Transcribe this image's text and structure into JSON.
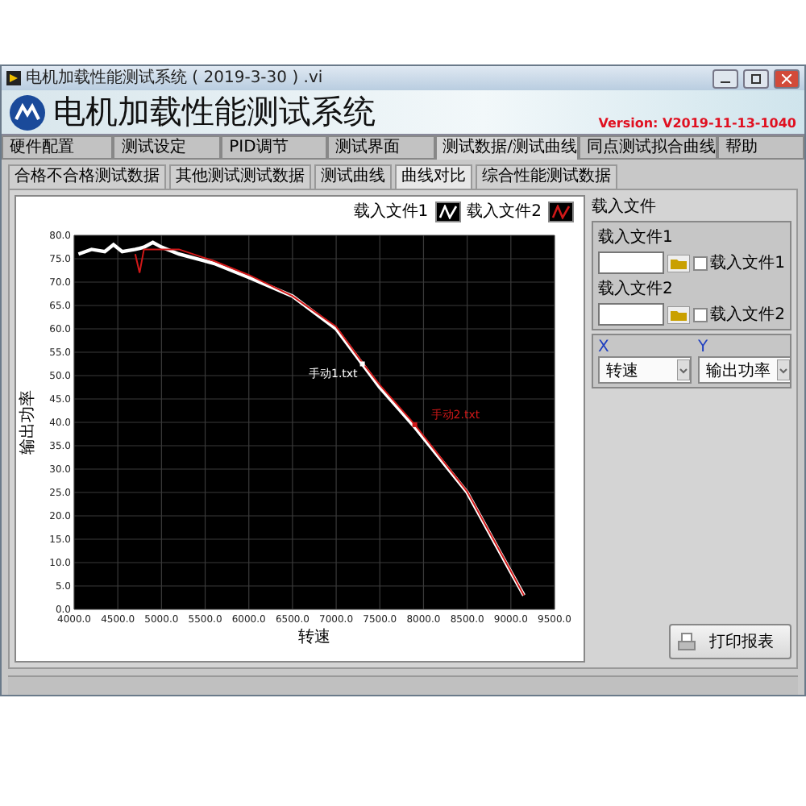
{
  "window": {
    "title": "电机加载性能测试系统 ( 2019-3-30 ) .vi"
  },
  "header": {
    "title": "电机加载性能测试系统",
    "version": "Version: V2019-11-13-1040"
  },
  "main_tabs": [
    {
      "label": "硬件配置",
      "selected": false
    },
    {
      "label": "测试设定",
      "selected": false
    },
    {
      "label": "PID调节",
      "selected": false
    },
    {
      "label": "测试界面",
      "selected": false
    },
    {
      "label": "测试数据/测试曲线",
      "selected": true
    },
    {
      "label": "同点测试拟合曲线",
      "selected": false
    },
    {
      "label": "帮助",
      "selected": false
    }
  ],
  "sub_tabs": [
    {
      "label": "合格不合格测试数据",
      "selected": false
    },
    {
      "label": "其他测试测试数据",
      "selected": false
    },
    {
      "label": "测试曲线",
      "selected": false
    },
    {
      "label": "曲线对比",
      "selected": true
    },
    {
      "label": "综合性能测试数据",
      "selected": false
    }
  ],
  "chart": {
    "chart_data": {
      "type": "line",
      "grid": true,
      "xlabel": "转速",
      "ylabel": "输出功率",
      "x": [
        4050,
        4200,
        4350,
        4450,
        4550,
        4700,
        4750,
        4800,
        4900,
        5000,
        5200,
        5600,
        6000,
        6500,
        7000,
        7300,
        7500,
        7900,
        8500,
        9000,
        9150
      ],
      "series": [
        {
          "name": "载入文件1",
          "color": "#ffffff",
          "values": [
            76,
            77,
            76.5,
            78,
            76.5,
            77,
            77.2,
            77.5,
            78.5,
            77.5,
            76,
            74,
            71,
            67,
            60,
            52.5,
            47.5,
            39,
            25,
            8,
            3
          ]
        },
        {
          "name": "载入文件2",
          "color": "#d01818",
          "values": [
            null,
            null,
            null,
            null,
            null,
            76,
            72,
            77,
            77,
            77,
            77,
            74.5,
            71.5,
            67,
            60.5,
            52.8,
            48,
            39.5,
            25.2,
            8.2,
            3
          ]
        }
      ],
      "xlim": [
        4000,
        9500
      ],
      "ylim": [
        0,
        80
      ],
      "xticks": [
        {
          "value": 4000,
          "label": "4000.0"
        },
        {
          "value": 4500,
          "label": "4500.0"
        },
        {
          "value": 5000,
          "label": "5000.0"
        },
        {
          "value": 5500,
          "label": "5500.0"
        },
        {
          "value": 6000,
          "label": "6000.0"
        },
        {
          "value": 6500,
          "label": "6500.0"
        },
        {
          "value": 7000,
          "label": "7000.0"
        },
        {
          "value": 7500,
          "label": "7500.0"
        },
        {
          "value": 8000,
          "label": "8000.0"
        },
        {
          "value": 8500,
          "label": "8500.0"
        },
        {
          "value": 9000,
          "label": "9000.0"
        },
        {
          "value": 9500,
          "label": "9500.0"
        }
      ],
      "yticks": [
        {
          "value": 0,
          "label": "0.0"
        },
        {
          "value": 5,
          "label": "5.0"
        },
        {
          "value": 10,
          "label": "10.0"
        },
        {
          "value": 15,
          "label": "15.0"
        },
        {
          "value": 20,
          "label": "20.0"
        },
        {
          "value": 25,
          "label": "25.0"
        },
        {
          "value": 30,
          "label": "30.0"
        },
        {
          "value": 35,
          "label": "35.0"
        },
        {
          "value": 40,
          "label": "40.0"
        },
        {
          "value": 45,
          "label": "45.0"
        },
        {
          "value": 50,
          "label": "50.0"
        },
        {
          "value": 55,
          "label": "55.0"
        },
        {
          "value": 60,
          "label": "60.0"
        },
        {
          "value": 65,
          "label": "65.0"
        },
        {
          "value": 70,
          "label": "70.0"
        },
        {
          "value": 75,
          "label": "75.0"
        },
        {
          "value": 80,
          "label": "80.0"
        }
      ],
      "annotations": [
        {
          "text": "手动1.txt",
          "x": 7300,
          "y": 52.5
        },
        {
          "text": "手动2.txt",
          "x": 7900,
          "y": 39.5
        }
      ]
    }
  },
  "load_panel": {
    "title": "载入文件",
    "files": [
      {
        "label": "载入文件1",
        "checkbox_label": "载入文件1",
        "checked": false
      },
      {
        "label": "载入文件2",
        "checkbox_label": "载入文件2",
        "checked": false
      }
    ]
  },
  "axis_select": [
    {
      "label": "X",
      "value": "转速"
    },
    {
      "label": "Y",
      "value": "输出功率"
    }
  ],
  "print_button": "打印报表"
}
